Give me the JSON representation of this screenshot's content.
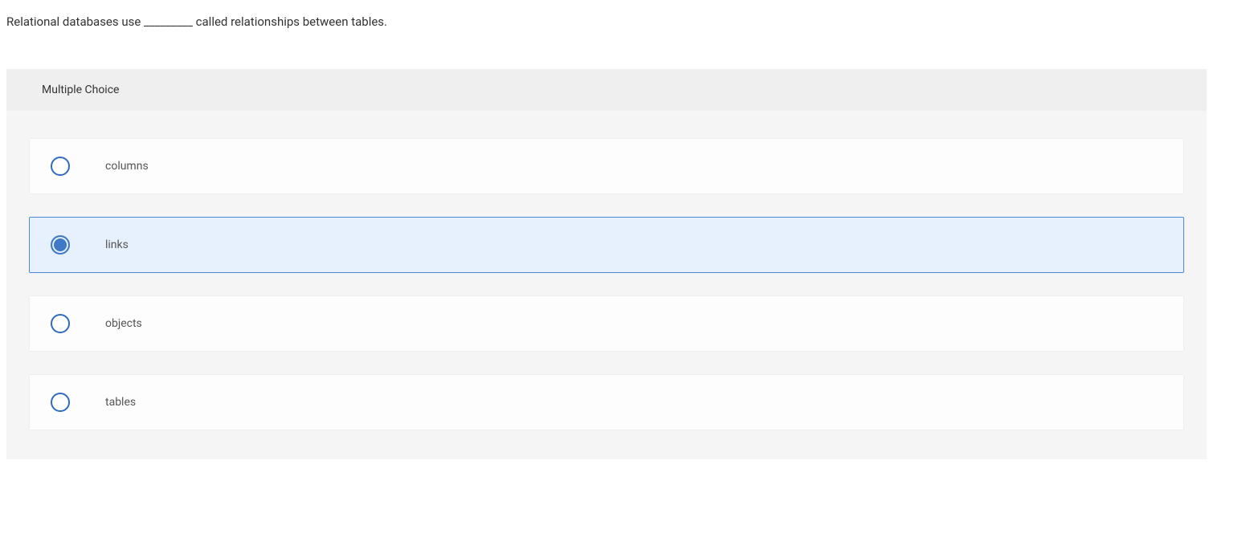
{
  "question": "Relational databases use _________ called relationships between tables.",
  "section_label": "Multiple Choice",
  "options": [
    {
      "label": "columns",
      "selected": false
    },
    {
      "label": "links",
      "selected": true
    },
    {
      "label": "objects",
      "selected": false
    },
    {
      "label": "tables",
      "selected": false
    }
  ]
}
